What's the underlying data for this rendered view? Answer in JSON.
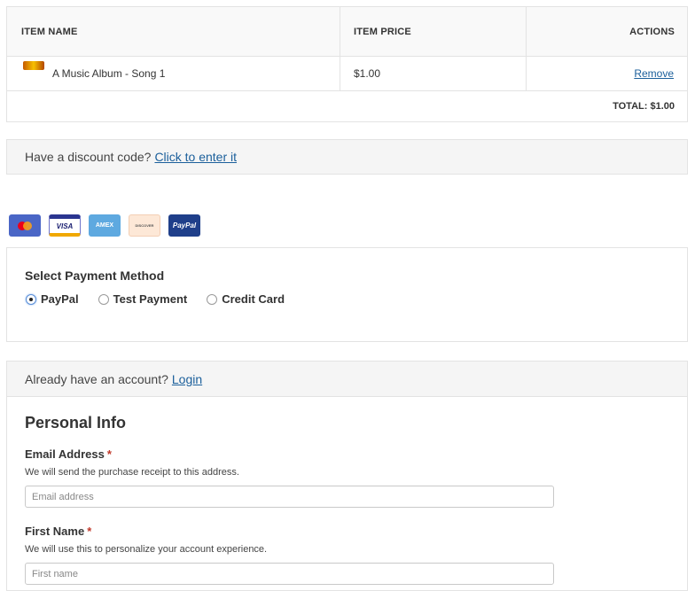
{
  "cart": {
    "headers": {
      "item_name": "ITEM NAME",
      "item_price": "ITEM PRICE",
      "actions": "ACTIONS"
    },
    "items": [
      {
        "name": "A Music Album - Song 1",
        "price": "$1.00",
        "action": "Remove",
        "thumb_icon": "album-thumbnail"
      }
    ],
    "total": "TOTAL: $1.00"
  },
  "discount": {
    "text": "Have a discount code?",
    "link": "Click to enter it"
  },
  "card_icons": [
    {
      "name": "mastercard-icon",
      "label": ""
    },
    {
      "name": "visa-icon",
      "label": "VISA"
    },
    {
      "name": "amex-icon",
      "label": "AMEX"
    },
    {
      "name": "discover-icon",
      "label": "DISCOVER"
    },
    {
      "name": "paypal-icon",
      "label": "PayPal"
    }
  ],
  "payment": {
    "heading": "Select Payment Method",
    "options": [
      {
        "label": "PayPal",
        "selected": true
      },
      {
        "label": "Test Payment",
        "selected": false
      },
      {
        "label": "Credit Card",
        "selected": false
      }
    ]
  },
  "account": {
    "text": "Already have an account?",
    "link": "Login"
  },
  "personal_info": {
    "title": "Personal Info",
    "email": {
      "label": "Email Address",
      "required_mark": "*",
      "description": "We will send the purchase receipt to this address.",
      "placeholder": "Email address",
      "value": ""
    },
    "first_name": {
      "label": "First Name",
      "required_mark": "*",
      "description": "We will use this to personalize your account experience.",
      "placeholder": "First name",
      "value": ""
    }
  },
  "colors": {
    "link": "#1b5f9b",
    "required": "#c0392b",
    "panel_bg": "#f5f5f5",
    "border": "#e3e3e3"
  }
}
